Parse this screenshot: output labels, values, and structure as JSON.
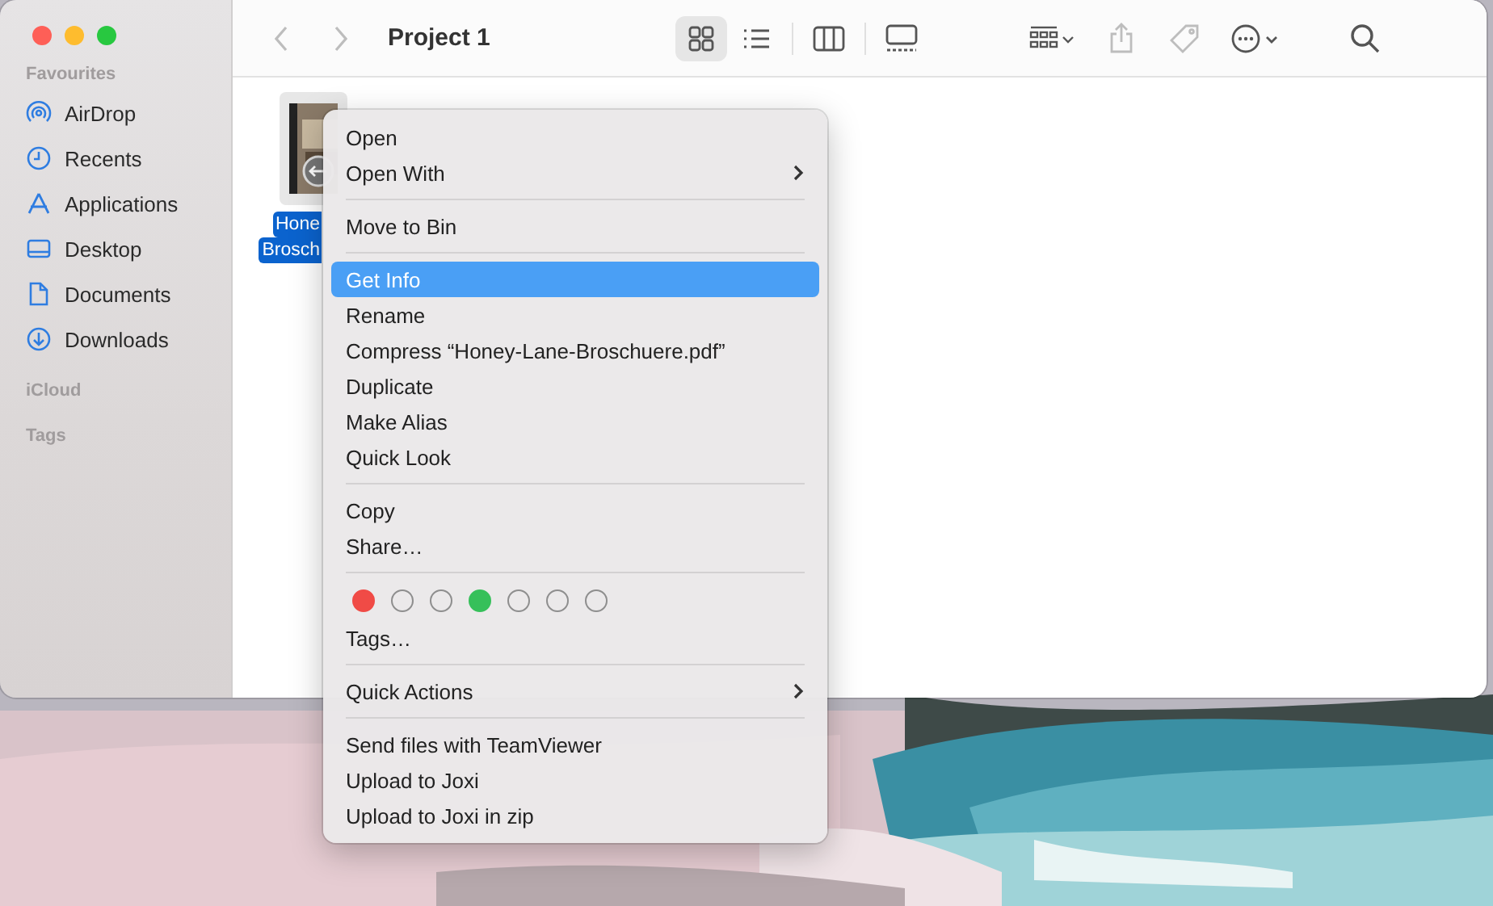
{
  "window": {
    "title": "Project 1"
  },
  "toolbar": {
    "nav": [
      {
        "kind": "back",
        "disabled": true
      },
      {
        "kind": "forward",
        "disabled": true
      }
    ],
    "views": [
      {
        "kind": "icons",
        "selected": true
      },
      {
        "kind": "list",
        "selected": false
      },
      {
        "kind": "columns",
        "selected": false
      },
      {
        "kind": "gallery",
        "selected": false
      }
    ],
    "actions": [
      {
        "kind": "group",
        "disabled": false
      },
      {
        "kind": "share",
        "disabled": true
      },
      {
        "kind": "tag",
        "disabled": true
      },
      {
        "kind": "more",
        "disabled": false
      },
      {
        "kind": "search",
        "disabled": false
      }
    ]
  },
  "sidebar": {
    "sections": [
      {
        "header": "Favourites",
        "items": [
          {
            "kind": "airdrop",
            "label": "AirDrop"
          },
          {
            "kind": "recents",
            "label": "Recents"
          },
          {
            "kind": "applications",
            "label": "Applications"
          },
          {
            "kind": "desktop",
            "label": "Desktop"
          },
          {
            "kind": "documents",
            "label": "Documents"
          },
          {
            "kind": "downloads",
            "label": "Downloads"
          }
        ]
      },
      {
        "header": "iCloud"
      },
      {
        "header": "Tags"
      }
    ]
  },
  "files": [
    {
      "name_lines": [
        "Hone",
        "Brosch"
      ],
      "selected": true
    }
  ],
  "menu": {
    "items": [
      {
        "kind": "item",
        "label": "Open",
        "selected": false,
        "submenu": false
      },
      {
        "kind": "item",
        "label": "Open With",
        "selected": false,
        "submenu": true
      },
      {
        "kind": "separator"
      },
      {
        "kind": "item",
        "label": "Move to Bin",
        "selected": false,
        "submenu": false
      },
      {
        "kind": "separator"
      },
      {
        "kind": "item",
        "label": "Get Info",
        "selected": true,
        "submenu": false
      },
      {
        "kind": "item",
        "label": "Rename",
        "selected": false,
        "submenu": false
      },
      {
        "kind": "item",
        "label": "Compress “Honey-Lane-Broschuere.pdf”",
        "selected": false,
        "submenu": false
      },
      {
        "kind": "item",
        "label": "Duplicate",
        "selected": false,
        "submenu": false
      },
      {
        "kind": "item",
        "label": "Make Alias",
        "selected": false,
        "submenu": false
      },
      {
        "kind": "item",
        "label": "Quick Look",
        "selected": false,
        "submenu": false
      },
      {
        "kind": "separator"
      },
      {
        "kind": "item",
        "label": "Copy",
        "selected": false,
        "submenu": false
      },
      {
        "kind": "item",
        "label": "Share…",
        "selected": false,
        "submenu": false
      },
      {
        "kind": "separator"
      },
      {
        "kind": "tags",
        "dots": [
          {
            "color": "#f04b46",
            "filled": true
          },
          {
            "color": "#8e8e8e",
            "filled": false
          },
          {
            "color": "#8e8e8e",
            "filled": false
          },
          {
            "color": "#36c05a",
            "filled": true
          },
          {
            "color": "#8e8e8e",
            "filled": false
          },
          {
            "color": "#8e8e8e",
            "filled": false
          },
          {
            "color": "#8e8e8e",
            "filled": false
          }
        ]
      },
      {
        "kind": "item",
        "label": "Tags…",
        "selected": false,
        "submenu": false
      },
      {
        "kind": "separator"
      },
      {
        "kind": "item",
        "label": "Quick Actions",
        "selected": false,
        "submenu": true
      },
      {
        "kind": "separator"
      },
      {
        "kind": "item",
        "label": "Send files with TeamViewer",
        "selected": false,
        "submenu": false
      },
      {
        "kind": "item",
        "label": "Upload to Joxi",
        "selected": false,
        "submenu": false
      },
      {
        "kind": "item",
        "label": "Upload to Joxi in zip",
        "selected": false,
        "submenu": false
      }
    ]
  }
}
